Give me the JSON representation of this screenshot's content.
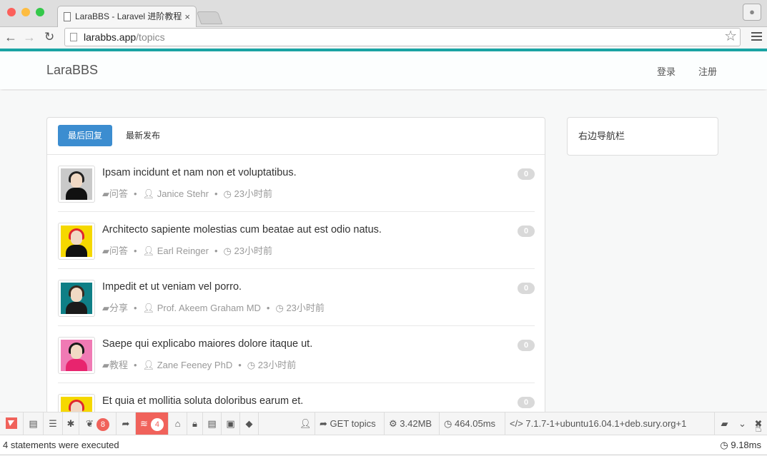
{
  "browser": {
    "tab_title": "LaraBBS - Laravel 进阶教程",
    "tab_close": "×",
    "url_host": "larabbs.app",
    "url_path": "/topics"
  },
  "site": {
    "brand": "LaraBBS",
    "login": "登录",
    "register": "注册"
  },
  "tabs": {
    "active": "最后回复",
    "other": "最新发布"
  },
  "topics": [
    {
      "title": "Ipsam incidunt et nam non et voluptatibus.",
      "category": "问答",
      "author": "Janice Stehr",
      "time": "23小时前",
      "replies": "0",
      "avatar_bg": "#c9c9c9",
      "hair": "#222222",
      "shirt": "#111111"
    },
    {
      "title": "Architecto sapiente molestias cum beatae aut est odio natus.",
      "category": "问答",
      "author": "Earl Reinger",
      "time": "23小时前",
      "replies": "0",
      "avatar_bg": "#f5d800",
      "hair": "#e0262e",
      "shirt": "#111111"
    },
    {
      "title": "Impedit et ut veniam vel porro.",
      "category": "分享",
      "author": "Prof. Akeem Graham MD",
      "time": "23小时前",
      "replies": "0",
      "avatar_bg": "#0f7f86",
      "hair": "#3a2a1f",
      "shirt": "#1b1b1b"
    },
    {
      "title": "Saepe qui explicabo maiores dolore itaque ut.",
      "category": "教程",
      "author": "Zane Feeney PhD",
      "time": "23小时前",
      "replies": "0",
      "avatar_bg": "#f07ab4",
      "hair": "#1a1a1a",
      "shirt": "#e8246e"
    },
    {
      "title": "Et quia et mollitia soluta doloribus earum et.",
      "category": "",
      "author": "",
      "time": "",
      "replies": "0",
      "avatar_bg": "#f5d800",
      "hair": "#e0262e",
      "shirt": "#111111"
    }
  ],
  "sidebar": {
    "title": "右边导航栏"
  },
  "debugbar": {
    "messages_count": "8",
    "queries_count": "4",
    "route": "GET topics",
    "memory": "3.42MB",
    "time": "464.05ms",
    "php_version": "7.1.7-1+ubuntu16.04.1+deb.sury.org+1",
    "statements_text": "4 statements were executed",
    "statements_time": "9.18ms"
  }
}
